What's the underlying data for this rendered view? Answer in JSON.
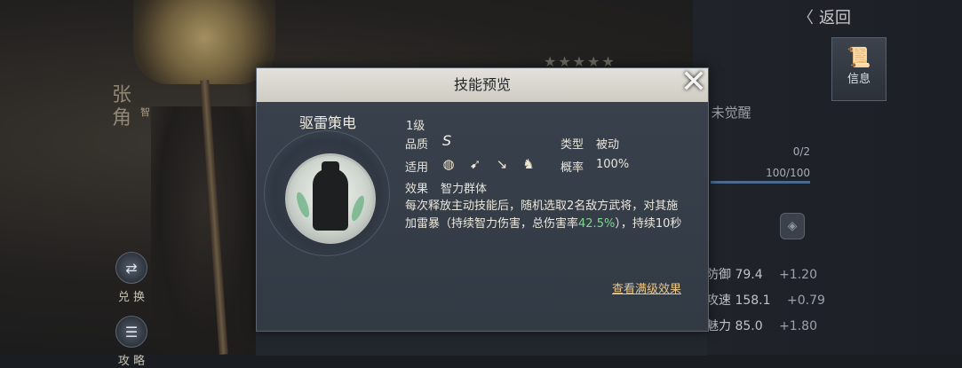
{
  "background": {
    "hero_name": "张角",
    "hero_tag": "智",
    "back_label": "返回",
    "side_buttons": [
      {
        "label": "兑 换",
        "icon": "exchange-icon"
      },
      {
        "label": "攻 略",
        "icon": "scroll-icon"
      }
    ],
    "info_tab": {
      "label": "信息",
      "icon": "scroll-icon"
    },
    "stars": "★★★★★",
    "awake_status": ") 未觉醒",
    "bar1": "0/2",
    "bar2": "100/100",
    "stats": [
      {
        "label": "防御",
        "value": "79.4",
        "bonus": "+1.20"
      },
      {
        "label": "攻速",
        "value": "158.1",
        "bonus": "+0.79"
      },
      {
        "label": "魅力",
        "value": "85.0",
        "bonus": "+1.80"
      }
    ]
  },
  "dialog": {
    "title": "技能预览",
    "skill_name": "驱雷策电",
    "level": "1级",
    "quality_label": "品质",
    "quality_value": "S",
    "type_label": "类型",
    "type_value": "被动",
    "applicable_label": "适用",
    "applicable_icons": [
      "shield-unit-icon",
      "bow-unit-icon",
      "spear-unit-icon",
      "cavalry-unit-icon"
    ],
    "rate_label": "概率",
    "rate_value": "100%",
    "effect_label": "效果",
    "effect_value": "智力群体",
    "description_1": "每次释放主动技能后，随机选取2名敌方武将，对其施加雷暴（持续智力伤害，总伤害率",
    "description_highlight": "42.5%",
    "description_2": "），持续10秒",
    "full_effect_link": "查看满级效果"
  },
  "colors": {
    "highlight": "#7fd58f",
    "link": "#e9c68a",
    "header_bg": "#e3e1da"
  }
}
